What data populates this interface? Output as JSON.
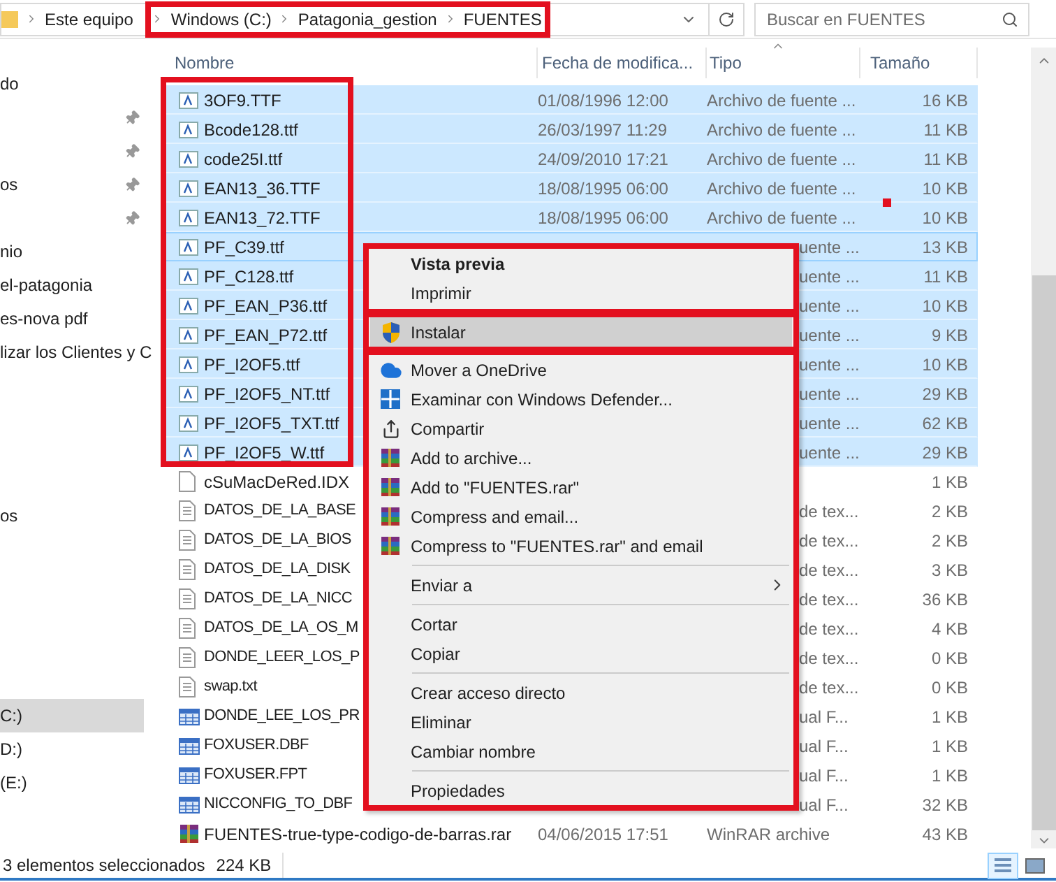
{
  "address_bar": {
    "crumbs": [
      "Este equipo",
      "Windows (C:)",
      "Patagonia_gestion",
      "FUENTES"
    ],
    "search": {
      "placeholder": "Buscar en FUENTES"
    }
  },
  "sidebar": {
    "groups": [
      {
        "items": [
          {
            "label": "do",
            "pinned": false,
            "selected": false
          },
          {
            "pinned": true,
            "selected": false
          },
          {
            "pinned": true,
            "selected": false
          },
          {
            "label": "os",
            "pinned": true,
            "selected": false
          },
          {
            "pinned": true,
            "selected": false
          },
          {
            "label": "nio",
            "pinned": false,
            "selected": false
          },
          {
            "label": "el-patagonia",
            "pinned": false,
            "selected": false
          },
          {
            "label": "es-nova pdf",
            "pinned": false,
            "selected": false
          },
          {
            "label": "lizar los Clientes y C",
            "pinned": false,
            "selected": false
          }
        ]
      },
      {
        "items": [
          {
            "label": "os",
            "pinned": false,
            "selected": false
          }
        ]
      },
      {
        "items": [
          {
            "label": "C:)",
            "pinned": false,
            "selected": true
          },
          {
            "label": "D:)",
            "pinned": false,
            "selected": false
          },
          {
            "label": "(E:)",
            "pinned": false,
            "selected": false
          }
        ]
      }
    ]
  },
  "table": {
    "columns": [
      "Nombre",
      "Fecha de modifica...",
      "Tipo",
      "Tamaño"
    ],
    "rows": [
      {
        "kind": "font",
        "name": "3OF9.TTF",
        "date": "01/08/1996 12:00",
        "type": "Archivo de fuente ...",
        "size": "16 KB",
        "selected": true,
        "focused": false,
        "covered": false
      },
      {
        "kind": "font",
        "name": "Bcode128.ttf",
        "date": "26/03/1997 11:29",
        "type": "Archivo de fuente ...",
        "size": "11 KB",
        "selected": true,
        "focused": false,
        "covered": false
      },
      {
        "kind": "font",
        "name": "code25I.ttf",
        "date": "24/09/2010 17:21",
        "type": "Archivo de fuente ...",
        "size": "11 KB",
        "selected": true,
        "focused": false,
        "covered": false
      },
      {
        "kind": "font",
        "name": "EAN13_36.TTF",
        "date": "18/08/1995 06:00",
        "type": "Archivo de fuente ...",
        "size": "10 KB",
        "selected": true,
        "focused": false,
        "covered": false
      },
      {
        "kind": "font",
        "name": "EAN13_72.TTF",
        "date": "18/08/1995 06:00",
        "type": "Archivo de fuente ...",
        "size": "10 KB",
        "selected": true,
        "focused": false,
        "covered": false
      },
      {
        "kind": "font",
        "name": "PF_C39.ttf",
        "type": "uente ...",
        "size": "13 KB",
        "selected": true,
        "focused": true,
        "covered": true
      },
      {
        "kind": "font",
        "name": "PF_C128.ttf",
        "type": "uente ...",
        "size": "11 KB",
        "selected": true,
        "focused": false,
        "covered": true
      },
      {
        "kind": "font",
        "name": "PF_EAN_P36.ttf",
        "type": "uente ...",
        "size": "10 KB",
        "selected": true,
        "focused": false,
        "covered": true
      },
      {
        "kind": "font",
        "name": "PF_EAN_P72.ttf",
        "type": "uente ...",
        "size": "9 KB",
        "selected": true,
        "focused": false,
        "covered": true
      },
      {
        "kind": "font",
        "name": "PF_I2OF5.ttf",
        "type": "uente ...",
        "size": "10 KB",
        "selected": true,
        "focused": false,
        "covered": true
      },
      {
        "kind": "font",
        "name": "PF_I2OF5_NT.ttf",
        "type": "uente ...",
        "size": "29 KB",
        "selected": true,
        "focused": false,
        "covered": true
      },
      {
        "kind": "font",
        "name": "PF_I2OF5_TXT.ttf",
        "type": "uente ...",
        "size": "62 KB",
        "selected": true,
        "focused": false,
        "covered": true
      },
      {
        "kind": "font",
        "name": "PF_I2OF5_W.ttf",
        "type": "uente ...",
        "size": "29 KB",
        "selected": true,
        "focused": false,
        "covered": true
      },
      {
        "kind": "blank",
        "name": "cSuMacDeRed.IDX",
        "size": "1 KB",
        "selected": false,
        "focused": false
      },
      {
        "kind": "text",
        "name": "DATOS_DE_LA_BASE",
        "type": "de tex...",
        "size": "2 KB",
        "selected": false,
        "focused": false,
        "covered": true
      },
      {
        "kind": "text",
        "name": "DATOS_DE_LA_BIOS",
        "type": "de tex...",
        "size": "2 KB",
        "selected": false,
        "focused": false,
        "covered": true
      },
      {
        "kind": "text",
        "name": "DATOS_DE_LA_DISK",
        "type": "de tex...",
        "size": "3 KB",
        "selected": false,
        "focused": false,
        "covered": true
      },
      {
        "kind": "text",
        "name": "DATOS_DE_LA_NICC",
        "type": "de tex...",
        "size": "36 KB",
        "selected": false,
        "focused": false,
        "covered": true
      },
      {
        "kind": "text",
        "name": "DATOS_DE_LA_OS_M",
        "type": "de tex...",
        "size": "4 KB",
        "selected": false,
        "focused": false,
        "covered": true
      },
      {
        "kind": "text",
        "name": "DONDE_LEER_LOS_P",
        "type": "de tex...",
        "size": "0 KB",
        "selected": false,
        "focused": false,
        "covered": true
      },
      {
        "kind": "text",
        "name": "swap.txt",
        "type": "de tex...",
        "size": "0 KB",
        "selected": false,
        "focused": false,
        "covered": true
      },
      {
        "kind": "table",
        "name": "DONDE_LEE_LOS_PR",
        "type": "ual F...",
        "size": "1 KB",
        "selected": false,
        "focused": false,
        "covered": true
      },
      {
        "kind": "table",
        "name": "FOXUSER.DBF",
        "type": "ual F...",
        "size": "1 KB",
        "selected": false,
        "focused": false,
        "covered": true
      },
      {
        "kind": "table",
        "name": "FOXUSER.FPT",
        "type": "ual F...",
        "size": "1 KB",
        "selected": false,
        "focused": false,
        "covered": true
      },
      {
        "kind": "table",
        "name": "NICCONFIG_TO_DBF",
        "type": "ual F...",
        "size": "32 KB",
        "selected": false,
        "focused": false,
        "covered": true
      },
      {
        "kind": "archive",
        "name": "FUENTES-true-type-codigo-de-barras.rar",
        "date": "04/06/2015 17:51",
        "type": "WinRAR archive",
        "size": "43 KB",
        "selected": false,
        "focused": false,
        "covered": false
      }
    ]
  },
  "context_menu": {
    "sections": [
      {
        "items": [
          {
            "kind": "plain",
            "label": "Vista previa",
            "default": true,
            "selected": false
          },
          {
            "kind": "plain",
            "label": "Imprimir",
            "default": false,
            "selected": false
          }
        ]
      },
      {
        "items": [
          {
            "kind": "shield",
            "label": "Instalar",
            "default": false,
            "selected": true
          }
        ]
      },
      {
        "items": [
          {
            "kind": "cloud",
            "label": "Mover a OneDrive",
            "default": false,
            "selected": false
          },
          {
            "kind": "defender",
            "label": "Examinar con Windows Defender...",
            "default": false,
            "selected": false
          },
          {
            "kind": "share",
            "label": "Compartir",
            "default": false,
            "selected": false
          },
          {
            "kind": "archive",
            "label": "Add to archive...",
            "default": false,
            "selected": false
          },
          {
            "kind": "archive",
            "label": "Add to \"FUENTES.rar\"",
            "default": false,
            "selected": false
          },
          {
            "kind": "archive",
            "label": "Compress and email...",
            "default": false,
            "selected": false
          },
          {
            "kind": "archive",
            "label": "Compress to \"FUENTES.rar\" and email",
            "default": false,
            "selected": false
          },
          {
            "kind": "separator"
          },
          {
            "kind": "submenu",
            "label": "Enviar a",
            "default": false,
            "selected": false
          },
          {
            "kind": "separator"
          },
          {
            "kind": "plain",
            "label": "Cortar",
            "default": false,
            "selected": false
          },
          {
            "kind": "plain",
            "label": "Copiar",
            "default": false,
            "selected": false
          },
          {
            "kind": "separator"
          },
          {
            "kind": "plain",
            "label": "Crear acceso directo",
            "default": false,
            "selected": false
          },
          {
            "kind": "plain",
            "label": "Eliminar",
            "default": false,
            "selected": false
          },
          {
            "kind": "plain",
            "label": "Cambiar nombre",
            "default": false,
            "selected": false
          },
          {
            "kind": "separator"
          },
          {
            "kind": "plain",
            "label": "Propiedades",
            "default": false,
            "selected": false
          }
        ]
      }
    ]
  },
  "status_bar": {
    "selection": "3 elementos seleccionados",
    "size": "224 KB"
  }
}
